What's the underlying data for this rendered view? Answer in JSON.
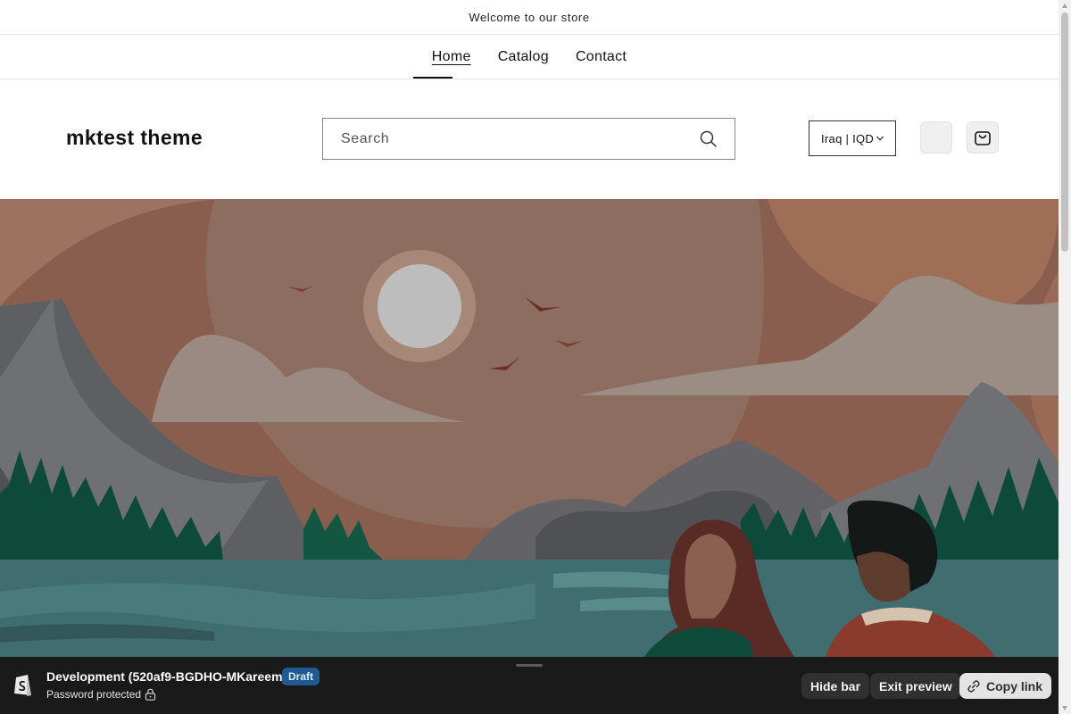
{
  "announcement": {
    "text": "Welcome to our store"
  },
  "nav": {
    "items": [
      {
        "label": "Home",
        "active": true
      },
      {
        "label": "Catalog",
        "active": false
      },
      {
        "label": "Contact",
        "active": false
      }
    ]
  },
  "header": {
    "logo": "mktest theme",
    "search": {
      "placeholder": "Search",
      "value": "",
      "icon": "search-icon"
    },
    "country_selector": {
      "value": "Iraq | IQD",
      "icon": "chevron-down-icon"
    },
    "account_icon": "account-icon",
    "cart_icon": "cart-icon"
  },
  "hero": {
    "type": "illustration",
    "description_icon": "landscape-illustration",
    "colors": {
      "sky": "#8c6d5f",
      "sun": "#bdbdbd",
      "water": "#3f6d70",
      "trees": "#0e4a3a",
      "mountains": "#6b6b6e"
    }
  },
  "preview_bar": {
    "theme_name": "Development (520af9-BGDHO-MKareem)",
    "badge": "Draft",
    "status": "Password protected",
    "buttons": {
      "hide": "Hide bar",
      "exit": "Exit preview",
      "copy": "Copy link"
    },
    "colors": {
      "background": "#1a1a1a",
      "badge": "#1f5a93"
    }
  }
}
